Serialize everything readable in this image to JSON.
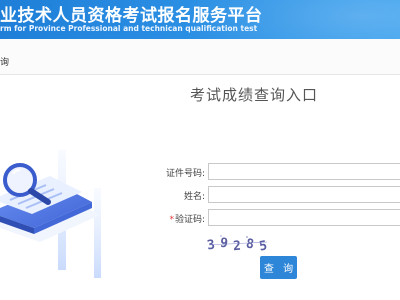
{
  "header": {
    "title": "业技术人员资格考试报名服务平台",
    "subtitle": "rm for Province Professional and technican qualification test"
  },
  "breadcrumb": {
    "text": "询"
  },
  "panel": {
    "title": "考试成绩查询入口"
  },
  "form": {
    "id_label": "证件号码:",
    "id_value": "",
    "name_label": "姓名:",
    "name_value": "",
    "captcha_label": "验证码:",
    "captcha_required_mark": "*",
    "captcha_value": "",
    "captcha_digits": [
      "3",
      "9",
      "2",
      "8",
      "5"
    ],
    "submit_label": "查 询"
  },
  "colors": {
    "header_blue": "#2a8ee3",
    "button_blue": "#2e86d8",
    "required_red": "#e03b3b"
  }
}
